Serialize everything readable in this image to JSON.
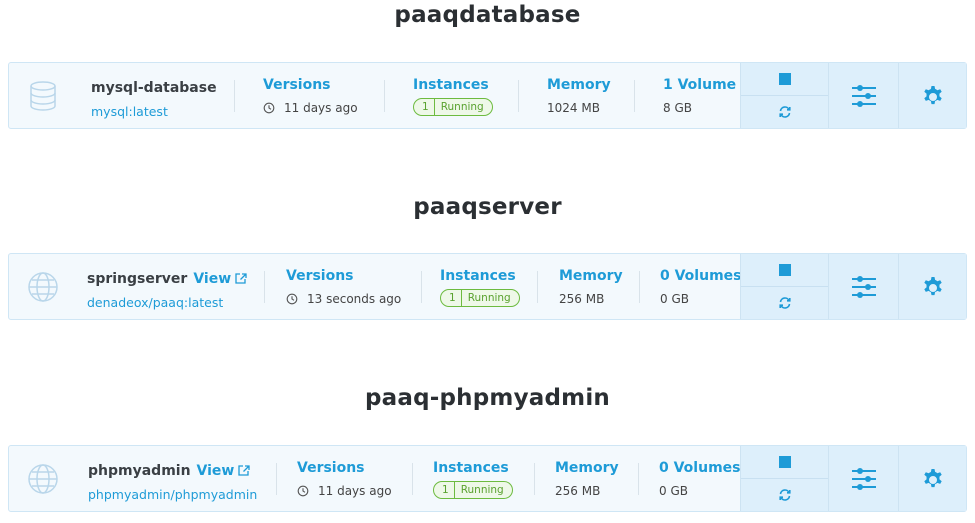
{
  "colors": {
    "accent": "#1e9bd7",
    "running": "#5aa22f"
  },
  "groups": [
    {
      "title": "paaqdatabase",
      "app": {
        "icon": "database-icon",
        "name": "mysql-database",
        "view_label": "",
        "image": "mysql:latest",
        "versions_label": "Versions",
        "versions_value": "11 days ago",
        "instances_label": "Instances",
        "instances_count": "1",
        "instances_status": "Running",
        "memory_label": "Memory",
        "memory_value": "1024 MB",
        "volumes_label": "1 Volume",
        "volumes_value": "8 GB"
      }
    },
    {
      "title": "paaqserver",
      "app": {
        "icon": "globe-icon",
        "name": "springserver",
        "view_label": "View",
        "image": "denadeox/paaq:latest",
        "versions_label": "Versions",
        "versions_value": "13 seconds ago",
        "instances_label": "Instances",
        "instances_count": "1",
        "instances_status": "Running",
        "memory_label": "Memory",
        "memory_value": "256 MB",
        "volumes_label": "0 Volumes",
        "volumes_value": "0 GB"
      }
    },
    {
      "title": "paaq-phpmyadmin",
      "app": {
        "icon": "globe-icon",
        "name": "phpmyadmin",
        "view_label": "View",
        "image": "phpmyadmin/phpmyadmin",
        "versions_label": "Versions",
        "versions_value": "11 days ago",
        "instances_label": "Instances",
        "instances_count": "1",
        "instances_status": "Running",
        "memory_label": "Memory",
        "memory_value": "256 MB",
        "volumes_label": "0 Volumes",
        "volumes_value": "0 GB"
      }
    }
  ]
}
